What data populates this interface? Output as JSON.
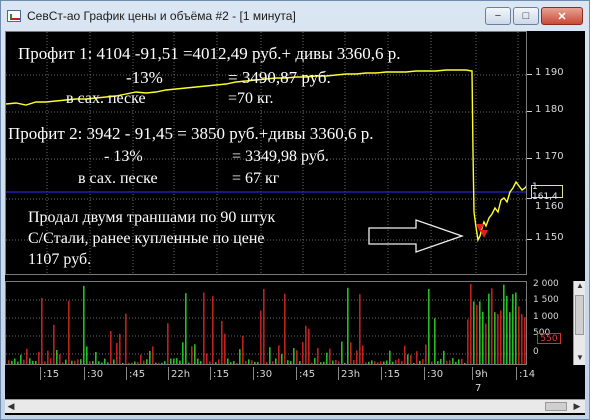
{
  "window": {
    "title": "СевСт-ао График цены и объёма #2 - [1 минута]",
    "minimize_glyph": "−",
    "maximize_glyph": "□",
    "close_glyph": "✕",
    "icon": "chart-app-icon"
  },
  "annotations": {
    "profit1_line1": "Профит 1: 4104  -91,51 =4012,49 руб.+ дивы 3360,6 р.",
    "profit1_line2": "-13%",
    "profit1_line2b": "= 3490,87 руб.",
    "profit1_line3": "в сах. песке",
    "profit1_line3b": "=70 кг.",
    "profit2_line1": "Профит 2:  3942  - 91,45 = 3850 руб.+дивы 3360,6 р.",
    "profit2_line2": "- 13%",
    "profit2_line2b": "= 3349,98 руб.",
    "profit2_line3": "в сах. песке",
    "profit2_line3b": "=  67 кг",
    "sold_line1": "Продал двумя траншами по 90 штук",
    "sold_line2": "С/Стали, ранее купленные по цене",
    "sold_line3": "1107 руб."
  },
  "price_axis": {
    "ticks": [
      "1 190",
      "1 180",
      "1 170",
      "1 160",
      "1 150"
    ],
    "current": "1 161,4"
  },
  "volume_axis": {
    "ticks": [
      "2 000",
      "1 500",
      "1 000",
      "500",
      "0"
    ],
    "current": "550"
  },
  "time_axis": {
    "labels": [
      ":15",
      ":30",
      ":45",
      "22h",
      ":15",
      ":30",
      ":45",
      "23h",
      ":15",
      ":30",
      "9h",
      ":14"
    ],
    "sub_label": "7"
  },
  "colors": {
    "background": "#000000",
    "price_line": "#ffff2a",
    "current_line": "#2020b0",
    "volume_up": "#22c022",
    "volume_down": "#c02020",
    "grid": "#6a6a6a"
  }
}
